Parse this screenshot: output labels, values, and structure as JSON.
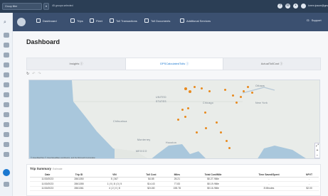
{
  "topbar": {
    "group_select": "Group filter",
    "group_note": "45 groups selected",
    "icons": [
      "help-icon",
      "mail-icon",
      "bell-icon"
    ],
    "user_name": "lorem.ipsum@gmail.com"
  },
  "nav": {
    "items": [
      {
        "label": "Dashboard",
        "icon": "dashboard-icon"
      },
      {
        "label": "Trips",
        "icon": "trips-icon"
      },
      {
        "label": "Fleet",
        "icon": "fleet-icon"
      },
      {
        "label": "Toll Transactions",
        "icon": "toll-icon"
      },
      {
        "label": "Toll Documents",
        "icon": "document-icon"
      },
      {
        "label": "Additional Services",
        "icon": "services-icon"
      }
    ],
    "support": "Support"
  },
  "page": {
    "title": "Dashboard"
  },
  "tabs": [
    {
      "label": "Insights ⓘ"
    },
    {
      "label": "GPSCalculatedTolls ⓘ"
    },
    {
      "label": "ActualTollCost ⓘ"
    }
  ],
  "toolbar": {
    "refresh": "↻",
    "undo": "↶",
    "redo": "↷"
  },
  "map": {
    "labels": [
      "UNITED",
      "STATES",
      "Chihuahua",
      "Monterrey",
      "MEXICO",
      "Chicago",
      "Houston",
      "Ottawa",
      "New York"
    ],
    "attribution": "© OpenMapTiles © OpenStreetMap contributors, and the Microsoft Corporation",
    "zoom_in": "+",
    "zoom_out": "−",
    "expand": "⤢"
  },
  "summary": {
    "title": "Trip Summary",
    "subtitle": "Estimate",
    "columns": [
      "Date",
      "Trip ID",
      "VIN",
      "Toll Cost",
      "Miles",
      "Total Cost/Mile",
      "Time Saved/Spent",
      "NPVT"
    ],
    "rows": [
      [
        "11/30/2023",
        "2861350",
        "5 | 367",
        "$4.85",
        "25.21",
        "$0.27 /Mile",
        "-",
        "-"
      ],
      [
        "11/30/2023",
        "2861355",
        "1 | 5 | 8 | 0 | 5",
        "$14.43",
        "77.83",
        "$0.19 /Mile",
        "-",
        "-"
      ],
      [
        "11/30/2023",
        "2861361",
        "4 | 2 | 0 | 8",
        "$24.80",
        "155.78",
        "$0.16 /Mile",
        "8 Minutes",
        "$2.00"
      ]
    ]
  }
}
